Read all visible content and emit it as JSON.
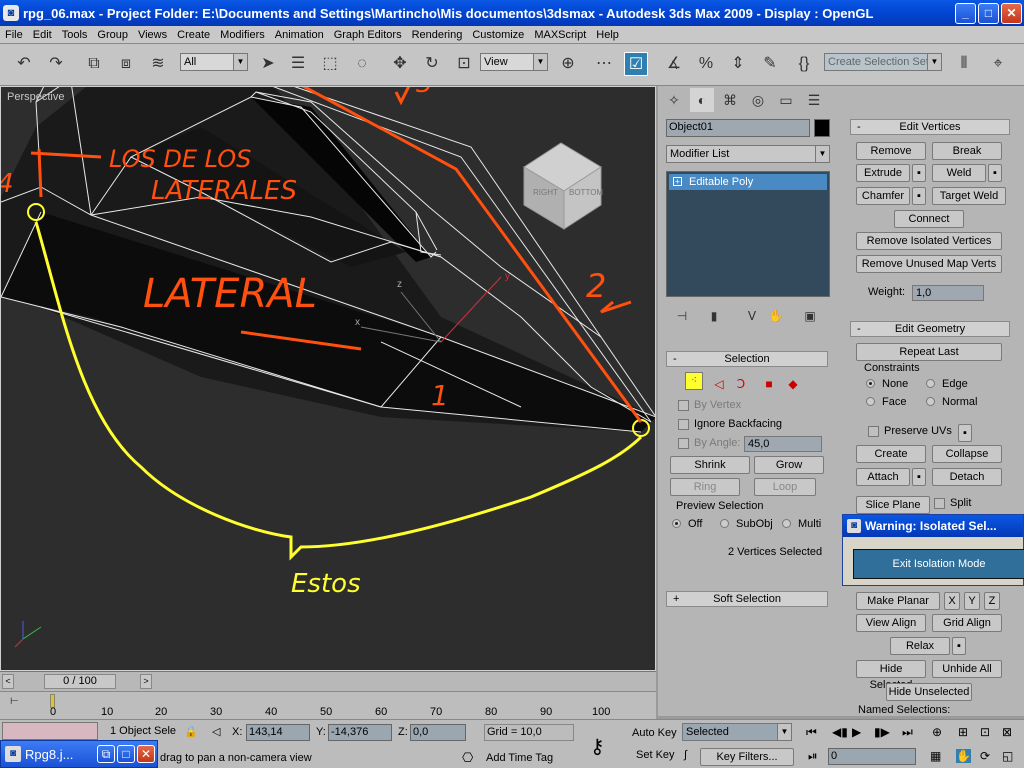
{
  "window": {
    "title": "rpg_06.max     - Project Folder: E:\\Documents and Settings\\Martincho\\Mis documentos\\3dsmax     - Autodesk 3ds Max  2009       - Display : OpenGL",
    "minimize": "_",
    "maximize": "□",
    "close": "✕"
  },
  "menu": [
    "File",
    "Edit",
    "Tools",
    "Group",
    "Views",
    "Create",
    "Modifiers",
    "Animation",
    "Graph Editors",
    "Rendering",
    "Customize",
    "MAXScript",
    "Help"
  ],
  "toolbar": {
    "selection_filter": "All",
    "ref_coord": "View",
    "named_selection_placeholder": "Create Selection Set",
    "icons": [
      "undo-icon",
      "redo-icon",
      "link-icon",
      "unlink-icon",
      "bind-space-warp-icon",
      "select-icon",
      "select-by-name-icon",
      "rect-region-icon",
      "window-crossing-icon",
      "move-icon",
      "rotate-icon",
      "scale-icon",
      "pivot-icon",
      "snap-icon",
      "angle-snap-icon",
      "percent-snap-icon",
      "spinner-snap-icon",
      "curly-braces-icon",
      "mirror-icon",
      "align-icon"
    ]
  },
  "viewport": {
    "label": "Perspective",
    "viewcube_faces": [
      "RIGHT",
      "BOTTOM"
    ],
    "annotations": {
      "los_de_los": "LOS DE LOS",
      "laterales": "LATERALES",
      "lateral": "LATERAL",
      "estos": "Estos",
      "num1": "1",
      "num2": "2",
      "num3": "3",
      "num4": "4"
    },
    "axis_x": "x",
    "axis_y": "y",
    "axis_z": "z"
  },
  "command_panel": {
    "tabs": [
      "create-tab-icon",
      "modify-tab-icon",
      "hierarchy-tab-icon",
      "motion-tab-icon",
      "display-tab-icon",
      "utilities-tab-icon"
    ],
    "object_name": "Object01",
    "modifier_list": "Modifier List",
    "stack_item": "Editable Poly",
    "stack_buttons": [
      "pin-stack-icon",
      "show-end-result-icon",
      "make-unique-icon",
      "remove-modifier-icon",
      "configure-modifier-sets-icon"
    ]
  },
  "selection": {
    "title": "Selection",
    "by_vertex": "By Vertex",
    "ignore_backfacing": "Ignore Backfacing",
    "by_angle": "By Angle:",
    "by_angle_value": "45,0",
    "shrink": "Shrink",
    "grow": "Grow",
    "ring": "Ring",
    "loop": "Loop",
    "preview_selection": "Preview Selection",
    "preview_options": [
      "Off",
      "SubObj",
      "Multi"
    ],
    "status": "2 Vertices Selected"
  },
  "soft_selection": {
    "title": "Soft Selection"
  },
  "edit_vertices": {
    "title": "Edit Vertices",
    "remove": "Remove",
    "break": "Break",
    "extrude": "Extrude",
    "weld": "Weld",
    "chamfer": "Chamfer",
    "target_weld": "Target Weld",
    "connect": "Connect",
    "remove_isolated": "Remove Isolated Vertices",
    "remove_unused": "Remove Unused Map Verts",
    "weight_label": "Weight:",
    "weight_value": "1,0"
  },
  "edit_geometry": {
    "title": "Edit Geometry",
    "repeat_last": "Repeat Last",
    "constraints": "Constraints",
    "none": "None",
    "edge": "Edge",
    "face": "Face",
    "normal": "Normal",
    "preserve_uvs": "Preserve UVs",
    "create": "Create",
    "collapse": "Collapse",
    "attach": "Attach",
    "detach": "Detach",
    "slice_plane": "Slice Plane",
    "split": "Split",
    "make_planar": "Make Planar",
    "x": "X",
    "y": "Y",
    "z": "Z",
    "view_align": "View Align",
    "grid_align": "Grid Align",
    "relax": "Relax",
    "hide_selected": "Hide Selected",
    "unhide_all": "Unhide All",
    "hide_unselected": "Hide Unselected",
    "named_selections": "Named Selections:"
  },
  "warning": {
    "title": "Warning: Isolated Sel...",
    "button": "Exit Isolation Mode"
  },
  "timeline": {
    "frame": "0 / 100",
    "ticks": [
      "0",
      "10",
      "20",
      "30",
      "40",
      "50",
      "60",
      "70",
      "80",
      "90",
      "100"
    ]
  },
  "status": {
    "object_count": "1 Object Sele",
    "x_label": "X:",
    "x_value": "143,14",
    "y_label": "Y:",
    "y_value": "-14,376",
    "z_label": "Z:",
    "z_value": "0,0",
    "grid": "Grid = 10,0",
    "prompt": "drag to pan a non-camera view",
    "add_time_tag": "Add Time Tag",
    "auto_key": "Auto Key",
    "set_key": "Set Key",
    "key_mode": "Selected",
    "key_filters": "Key Filters...",
    "frame_value": "0"
  },
  "taskbar": {
    "item": "Rpg8.j..."
  },
  "colors": {
    "title_blue": "#0348d6",
    "orange_annotation": "#ff5010",
    "yellow_annotation": "#ffff30",
    "viewport_bg": "#2d2d2d",
    "selected_highlight": "#2f7fb0"
  }
}
